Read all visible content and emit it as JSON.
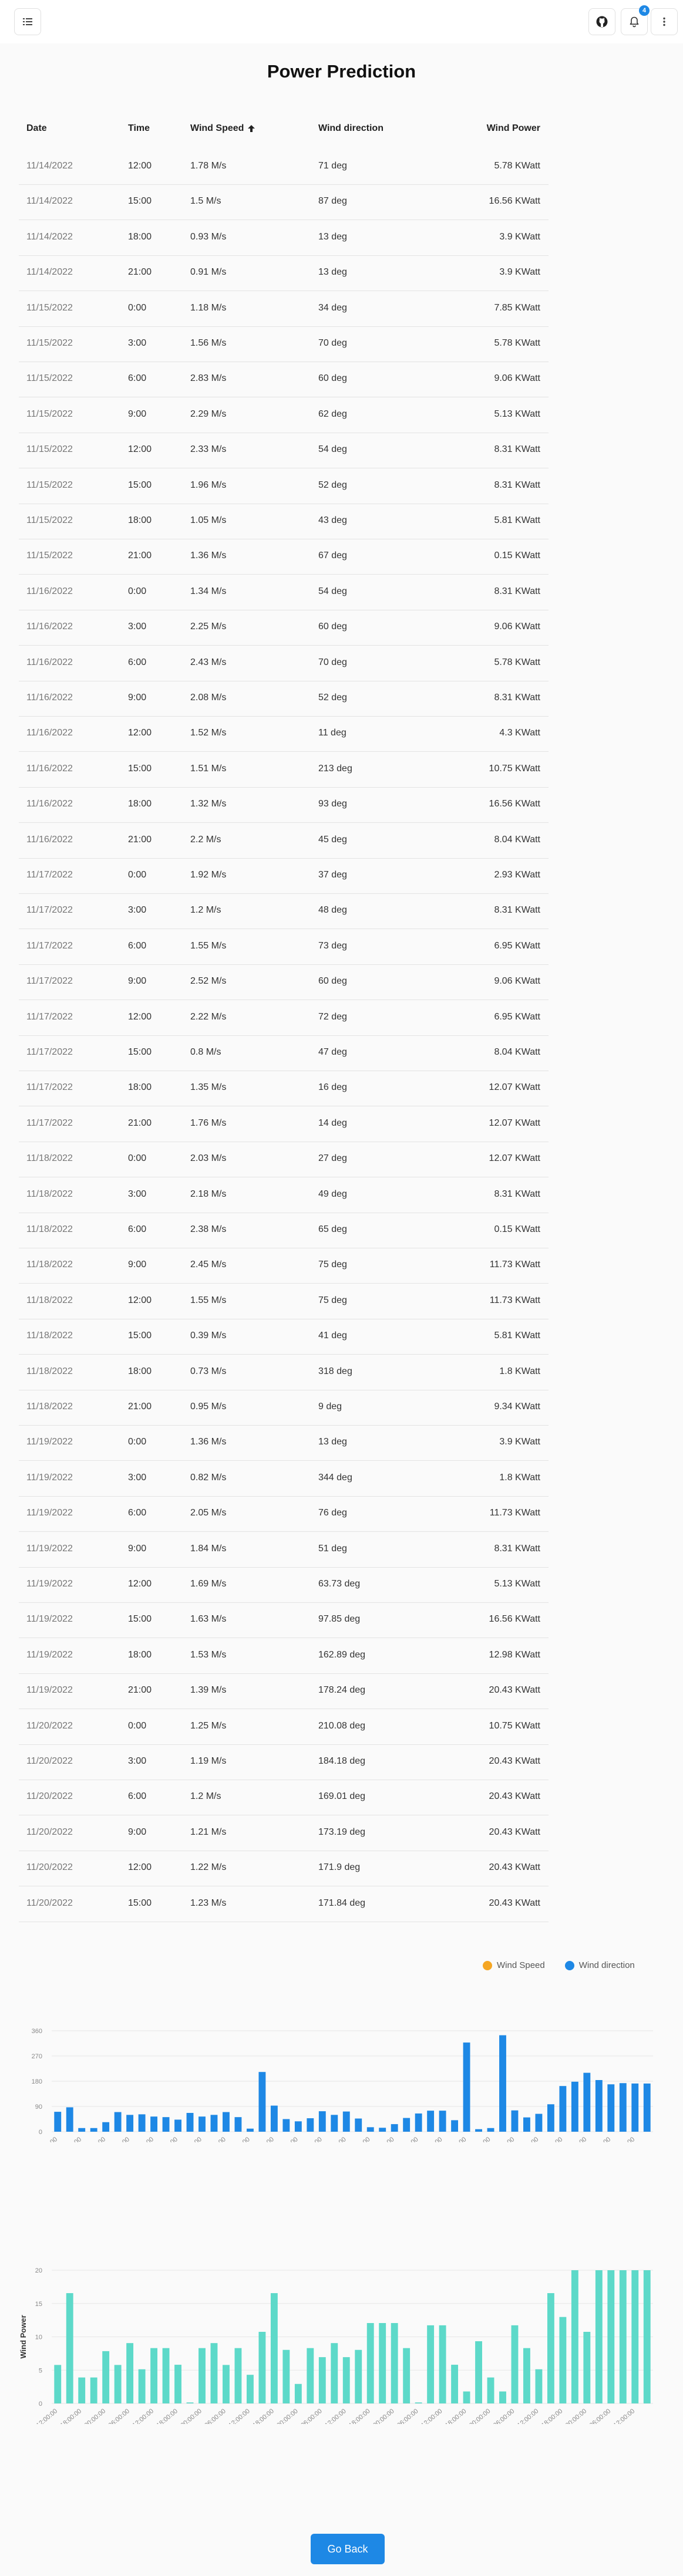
{
  "header": {
    "menu_icon": "menu-icon",
    "github_icon": "github-icon",
    "bell_icon": "bell-icon",
    "notification_count": "4",
    "more_icon": "more-vertical-icon"
  },
  "page": {
    "title": "Power Prediction"
  },
  "table": {
    "columns": [
      "Date",
      "Time",
      "Wind Speed",
      "Wind direction",
      "Wind Power"
    ],
    "sort_icon": "arrow-up-icon",
    "rows": [
      [
        "11/14/2022",
        "12:00",
        "1.78 M/s",
        "71 deg",
        "5.78 KWatt"
      ],
      [
        "11/14/2022",
        "15:00",
        "1.5 M/s",
        "87 deg",
        "16.56 KWatt"
      ],
      [
        "11/14/2022",
        "18:00",
        "0.93 M/s",
        "13 deg",
        "3.9 KWatt"
      ],
      [
        "11/14/2022",
        "21:00",
        "0.91 M/s",
        "13 deg",
        "3.9 KWatt"
      ],
      [
        "11/15/2022",
        "0:00",
        "1.18 M/s",
        "34 deg",
        "7.85 KWatt"
      ],
      [
        "11/15/2022",
        "3:00",
        "1.56 M/s",
        "70 deg",
        "5.78 KWatt"
      ],
      [
        "11/15/2022",
        "6:00",
        "2.83 M/s",
        "60 deg",
        "9.06 KWatt"
      ],
      [
        "11/15/2022",
        "9:00",
        "2.29 M/s",
        "62 deg",
        "5.13 KWatt"
      ],
      [
        "11/15/2022",
        "12:00",
        "2.33 M/s",
        "54 deg",
        "8.31 KWatt"
      ],
      [
        "11/15/2022",
        "15:00",
        "1.96 M/s",
        "52 deg",
        "8.31 KWatt"
      ],
      [
        "11/15/2022",
        "18:00",
        "1.05 M/s",
        "43 deg",
        "5.81 KWatt"
      ],
      [
        "11/15/2022",
        "21:00",
        "1.36 M/s",
        "67 deg",
        "0.15 KWatt"
      ],
      [
        "11/16/2022",
        "0:00",
        "1.34 M/s",
        "54 deg",
        "8.31 KWatt"
      ],
      [
        "11/16/2022",
        "3:00",
        "2.25 M/s",
        "60 deg",
        "9.06 KWatt"
      ],
      [
        "11/16/2022",
        "6:00",
        "2.43 M/s",
        "70 deg",
        "5.78 KWatt"
      ],
      [
        "11/16/2022",
        "9:00",
        "2.08 M/s",
        "52 deg",
        "8.31 KWatt"
      ],
      [
        "11/16/2022",
        "12:00",
        "1.52 M/s",
        "11 deg",
        "4.3 KWatt"
      ],
      [
        "11/16/2022",
        "15:00",
        "1.51 M/s",
        "213 deg",
        "10.75 KWatt"
      ],
      [
        "11/16/2022",
        "18:00",
        "1.32 M/s",
        "93 deg",
        "16.56 KWatt"
      ],
      [
        "11/16/2022",
        "21:00",
        "2.2 M/s",
        "45 deg",
        "8.04 KWatt"
      ],
      [
        "11/17/2022",
        "0:00",
        "1.92 M/s",
        "37 deg",
        "2.93 KWatt"
      ],
      [
        "11/17/2022",
        "3:00",
        "1.2 M/s",
        "48 deg",
        "8.31 KWatt"
      ],
      [
        "11/17/2022",
        "6:00",
        "1.55 M/s",
        "73 deg",
        "6.95 KWatt"
      ],
      [
        "11/17/2022",
        "9:00",
        "2.52 M/s",
        "60 deg",
        "9.06 KWatt"
      ],
      [
        "11/17/2022",
        "12:00",
        "2.22 M/s",
        "72 deg",
        "6.95 KWatt"
      ],
      [
        "11/17/2022",
        "15:00",
        "0.8 M/s",
        "47 deg",
        "8.04 KWatt"
      ],
      [
        "11/17/2022",
        "18:00",
        "1.35 M/s",
        "16 deg",
        "12.07 KWatt"
      ],
      [
        "11/17/2022",
        "21:00",
        "1.76 M/s",
        "14 deg",
        "12.07 KWatt"
      ],
      [
        "11/18/2022",
        "0:00",
        "2.03 M/s",
        "27 deg",
        "12.07 KWatt"
      ],
      [
        "11/18/2022",
        "3:00",
        "2.18 M/s",
        "49 deg",
        "8.31 KWatt"
      ],
      [
        "11/18/2022",
        "6:00",
        "2.38 M/s",
        "65 deg",
        "0.15 KWatt"
      ],
      [
        "11/18/2022",
        "9:00",
        "2.45 M/s",
        "75 deg",
        "11.73 KWatt"
      ],
      [
        "11/18/2022",
        "12:00",
        "1.55 M/s",
        "75 deg",
        "11.73 KWatt"
      ],
      [
        "11/18/2022",
        "15:00",
        "0.39 M/s",
        "41 deg",
        "5.81 KWatt"
      ],
      [
        "11/18/2022",
        "18:00",
        "0.73 M/s",
        "318 deg",
        "1.8 KWatt"
      ],
      [
        "11/18/2022",
        "21:00",
        "0.95 M/s",
        "9 deg",
        "9.34 KWatt"
      ],
      [
        "11/19/2022",
        "0:00",
        "1.36 M/s",
        "13 deg",
        "3.9 KWatt"
      ],
      [
        "11/19/2022",
        "3:00",
        "0.82 M/s",
        "344 deg",
        "1.8 KWatt"
      ],
      [
        "11/19/2022",
        "6:00",
        "2.05 M/s",
        "76 deg",
        "11.73 KWatt"
      ],
      [
        "11/19/2022",
        "9:00",
        "1.84 M/s",
        "51 deg",
        "8.31 KWatt"
      ],
      [
        "11/19/2022",
        "12:00",
        "1.69 M/s",
        "63.73 deg",
        "5.13 KWatt"
      ],
      [
        "11/19/2022",
        "15:00",
        "1.63 M/s",
        "97.85 deg",
        "16.56 KWatt"
      ],
      [
        "11/19/2022",
        "18:00",
        "1.53 M/s",
        "162.89 deg",
        "12.98 KWatt"
      ],
      [
        "11/19/2022",
        "21:00",
        "1.39 M/s",
        "178.24 deg",
        "20.43 KWatt"
      ],
      [
        "11/20/2022",
        "0:00",
        "1.25 M/s",
        "210.08 deg",
        "10.75 KWatt"
      ],
      [
        "11/20/2022",
        "3:00",
        "1.19 M/s",
        "184.18 deg",
        "20.43 KWatt"
      ],
      [
        "11/20/2022",
        "6:00",
        "1.2 M/s",
        "169.01 deg",
        "20.43 KWatt"
      ],
      [
        "11/20/2022",
        "9:00",
        "1.21 M/s",
        "173.19 deg",
        "20.43 KWatt"
      ],
      [
        "11/20/2022",
        "12:00",
        "1.22 M/s",
        "171.9 deg",
        "20.43 KWatt"
      ],
      [
        "11/20/2022",
        "15:00",
        "1.23 M/s",
        "171.84 deg",
        "20.43 KWatt"
      ]
    ]
  },
  "legend": {
    "speed_label": "Wind Speed",
    "direction_label": "Wind direction"
  },
  "colors": {
    "speed": "#f5a623",
    "direction": "#1e88e5",
    "power": "#5dd9c9",
    "primary": "#1e88e5"
  },
  "chart_data": [
    {
      "type": "bar",
      "series": [
        {
          "name": "Wind Speed",
          "values": [
            1.78,
            1.5,
            0.93,
            0.91,
            1.18,
            1.56,
            2.83,
            2.29,
            2.33,
            1.96,
            1.05,
            1.36,
            1.34,
            2.25,
            2.43,
            2.08,
            1.52,
            1.51,
            1.32,
            2.2,
            1.92,
            1.2,
            1.55,
            2.52,
            2.22,
            0.8,
            1.35,
            1.76,
            2.03,
            2.18,
            2.38,
            2.45,
            1.55,
            0.39,
            0.73,
            0.95,
            1.36,
            0.82,
            2.05,
            1.84,
            1.69,
            1.63,
            1.53,
            1.39,
            1.25,
            1.19,
            1.2,
            1.21,
            1.22,
            1.23
          ]
        },
        {
          "name": "Wind direction",
          "values": [
            71,
            87,
            13,
            13,
            34,
            70,
            60,
            62,
            54,
            52,
            43,
            67,
            54,
            60,
            70,
            52,
            11,
            213,
            93,
            45,
            37,
            48,
            73,
            60,
            72,
            47,
            16,
            14,
            27,
            49,
            65,
            75,
            75,
            41,
            318,
            9,
            13,
            344,
            76,
            51,
            63.73,
            97.85,
            162.89,
            178.24,
            210.08,
            184.18,
            169.01,
            173.19,
            171.9,
            171.84
          ]
        }
      ],
      "categories": [
        "2022-11-14 12:00:00",
        "2022-11-14 15:00:00",
        "2022-11-14 18:00:00",
        "2022-11-14 21:00:00",
        "2022-11-15 00:00:00",
        "2022-11-15 03:00:00",
        "2022-11-15 06:00:00",
        "2022-11-15 09:00:00",
        "2022-11-15 12:00:00",
        "2022-11-15 15:00:00",
        "2022-11-15 18:00:00",
        "2022-11-15 21:00:00",
        "2022-11-16 00:00:00",
        "2022-11-16 03:00:00",
        "2022-11-16 06:00:00",
        "2022-11-16 09:00:00",
        "2022-11-16 12:00:00",
        "2022-11-16 15:00:00",
        "2022-11-16 18:00:00",
        "2022-11-16 21:00:00",
        "2022-11-17 00:00:00",
        "2022-11-17 03:00:00",
        "2022-11-17 06:00:00",
        "2022-11-17 09:00:00",
        "2022-11-17 12:00:00",
        "2022-11-17 15:00:00",
        "2022-11-17 18:00:00",
        "2022-11-17 21:00:00",
        "2022-11-18 00:00:00",
        "2022-11-18 03:00:00",
        "2022-11-18 06:00:00",
        "2022-11-18 09:00:00",
        "2022-11-18 12:00:00",
        "2022-11-18 15:00:00",
        "2022-11-18 18:00:00",
        "2022-11-18 21:00:00",
        "2022-11-19 00:00:00",
        "2022-11-19 03:00:00",
        "2022-11-19 06:00:00",
        "2022-11-19 09:00:00",
        "2022-11-19 12:00:00",
        "2022-11-19 15:00:00",
        "2022-11-19 18:00:00",
        "2022-11-19 21:00:00",
        "2022-11-20 00:00:00",
        "2022-11-20 03:00:00",
        "2022-11-20 06:00:00",
        "2022-11-20 09:00:00",
        "2022-11-20 12:00:00",
        "2022-11-20 15:00:00"
      ],
      "yticks": [
        0,
        90,
        180,
        270,
        360
      ],
      "ylim": [
        0,
        360
      ],
      "grid": true,
      "legend_position": "top-right"
    },
    {
      "type": "bar",
      "ylabel": "Wind Power",
      "series": [
        {
          "values": [
            5.78,
            16.56,
            3.9,
            3.9,
            7.85,
            5.78,
            9.06,
            5.13,
            8.31,
            8.31,
            5.81,
            0.15,
            8.31,
            9.06,
            5.78,
            8.31,
            4.3,
            10.75,
            16.56,
            8.04,
            2.93,
            8.31,
            6.95,
            9.06,
            6.95,
            8.04,
            12.07,
            12.07,
            12.07,
            8.31,
            0.15,
            11.73,
            11.73,
            5.81,
            1.8,
            9.34,
            3.9,
            1.8,
            11.73,
            8.31,
            5.13,
            16.56,
            12.98,
            20.43,
            10.75,
            20.43,
            20.43,
            20.43,
            20.43,
            20.43
          ]
        }
      ],
      "yticks": [
        0,
        5,
        10,
        15,
        20
      ],
      "ylim": [
        0,
        20
      ],
      "grid": true
    }
  ],
  "actions": {
    "go_back_label": "Go Back"
  }
}
